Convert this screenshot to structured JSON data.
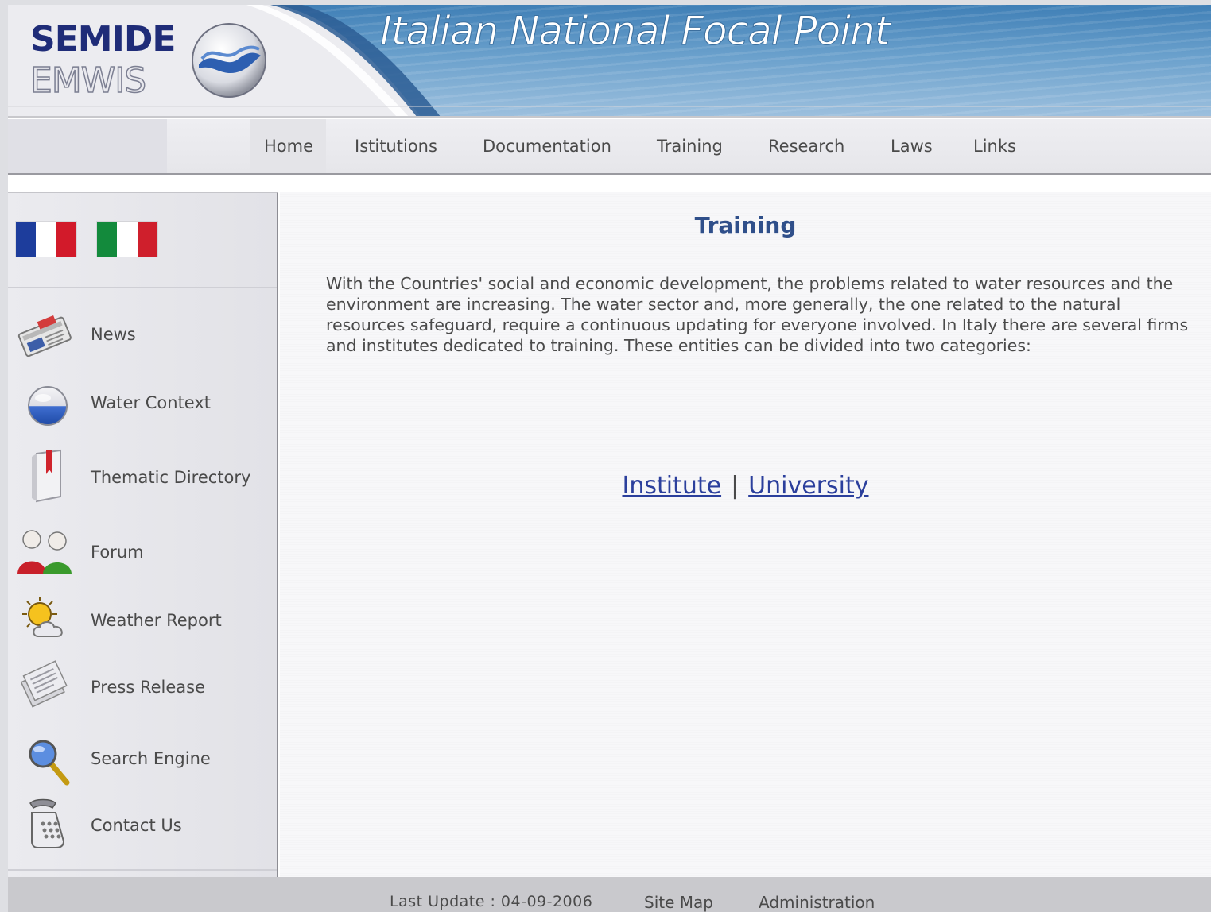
{
  "header": {
    "logo_top": "SEMIDE",
    "logo_bottom": "EMWIS",
    "site_title": "Italian National Focal Point"
  },
  "nav": {
    "items": [
      "Home",
      "Istitutions",
      "Documentation",
      "Training",
      "Research",
      "Laws",
      "Links"
    ]
  },
  "sidebar": {
    "flags": [
      {
        "name": "france",
        "colors": [
          "#1d3d9c",
          "#ffffff",
          "#d21a2a"
        ]
      },
      {
        "name": "italy",
        "colors": [
          "#138a3c",
          "#ffffff",
          "#cf1f2c"
        ]
      }
    ],
    "items": [
      {
        "label": "News",
        "icon": "newspaper-icon"
      },
      {
        "label": "Water Context",
        "icon": "water-drop-icon"
      },
      {
        "label": "Thematic Directory",
        "icon": "bookmark-book-icon"
      },
      {
        "label": "Forum",
        "icon": "users-icon"
      },
      {
        "label": "Weather Report",
        "icon": "sun-cloud-icon"
      },
      {
        "label": "Press Release",
        "icon": "documents-icon"
      },
      {
        "label": "Search Engine",
        "icon": "magnifier-icon"
      },
      {
        "label": "Contact Us",
        "icon": "telephone-icon"
      }
    ]
  },
  "main": {
    "title": "Training",
    "paragraph": "With the Countries' social and economic development, the problems related to water resources and the environment are increasing. The water sector and, more generally, the one related to the natural resources safeguard, require a continuous updating for everyone involved. In Italy there are several firms and institutes dedicated to training. These entities can be divided into two categories:",
    "links": {
      "institute": "Institute",
      "separator": "|",
      "university": "University"
    }
  },
  "footer": {
    "last_update": "Last Update : 04-09-2006",
    "site_map": "Site Map",
    "administration": "Administration"
  },
  "colors": {
    "title_blue": "#2f4f8a",
    "link_blue": "#2b3f9c",
    "logo_navy": "#1f2c78"
  }
}
